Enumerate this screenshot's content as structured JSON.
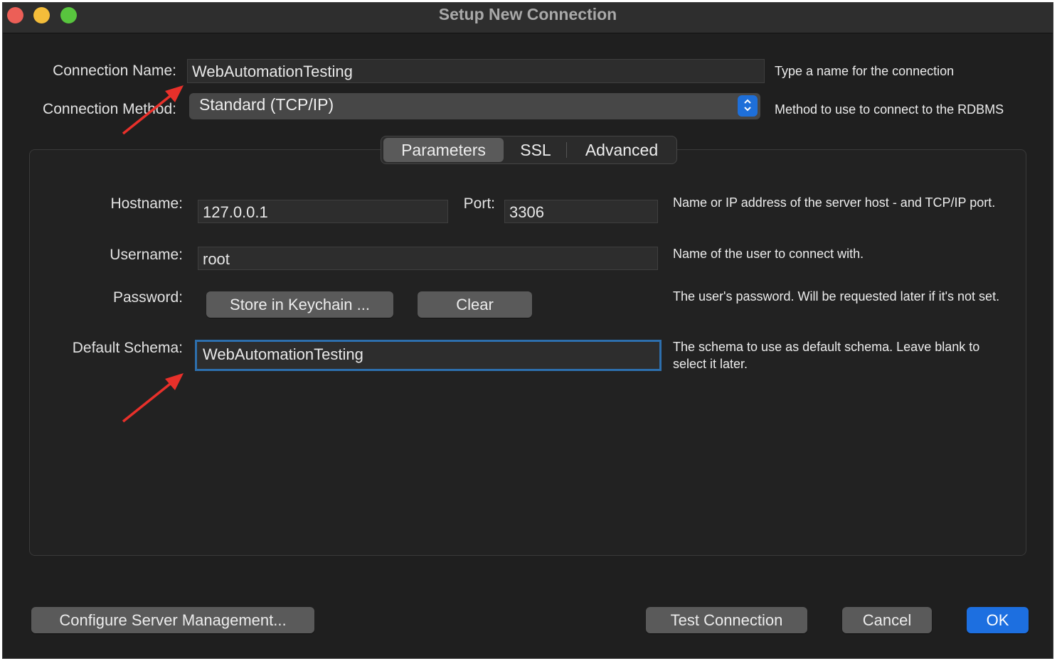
{
  "window": {
    "title": "Setup New Connection"
  },
  "connection": {
    "name_label": "Connection Name:",
    "name_value": "WebAutomationTesting",
    "name_help": "Type a name for the connection",
    "method_label": "Connection Method:",
    "method_value": "Standard (TCP/IP)",
    "method_help": "Method to use to connect to the RDBMS"
  },
  "tabs": [
    {
      "label": "Parameters",
      "active": true
    },
    {
      "label": "SSL",
      "active": false
    },
    {
      "label": "Advanced",
      "active": false
    }
  ],
  "params": {
    "hostname_label": "Hostname:",
    "hostname_value": "127.0.0.1",
    "port_label": "Port:",
    "port_value": "3306",
    "hostname_help": "Name or IP address of the server host - and TCP/IP port.",
    "username_label": "Username:",
    "username_value": "root",
    "username_help": "Name of the user to connect with.",
    "password_label": "Password:",
    "store_keychain_label": "Store in Keychain ...",
    "clear_label": "Clear",
    "password_help": "The user's password. Will be requested later if it's not set.",
    "schema_label": "Default Schema:",
    "schema_value": "WebAutomationTesting",
    "schema_help": "The schema to use as default schema. Leave blank to select it later."
  },
  "footer": {
    "configure_label": "Configure Server Management...",
    "test_label": "Test Connection",
    "cancel_label": "Cancel",
    "ok_label": "OK"
  },
  "colors": {
    "accent": "#1d6fe0",
    "focus_ring": "#2d6fad",
    "annotation_arrow": "#e8302a"
  },
  "icons": {
    "select_stepper": "chevron-up-down-icon",
    "annotation": "red-arrow-icon"
  }
}
